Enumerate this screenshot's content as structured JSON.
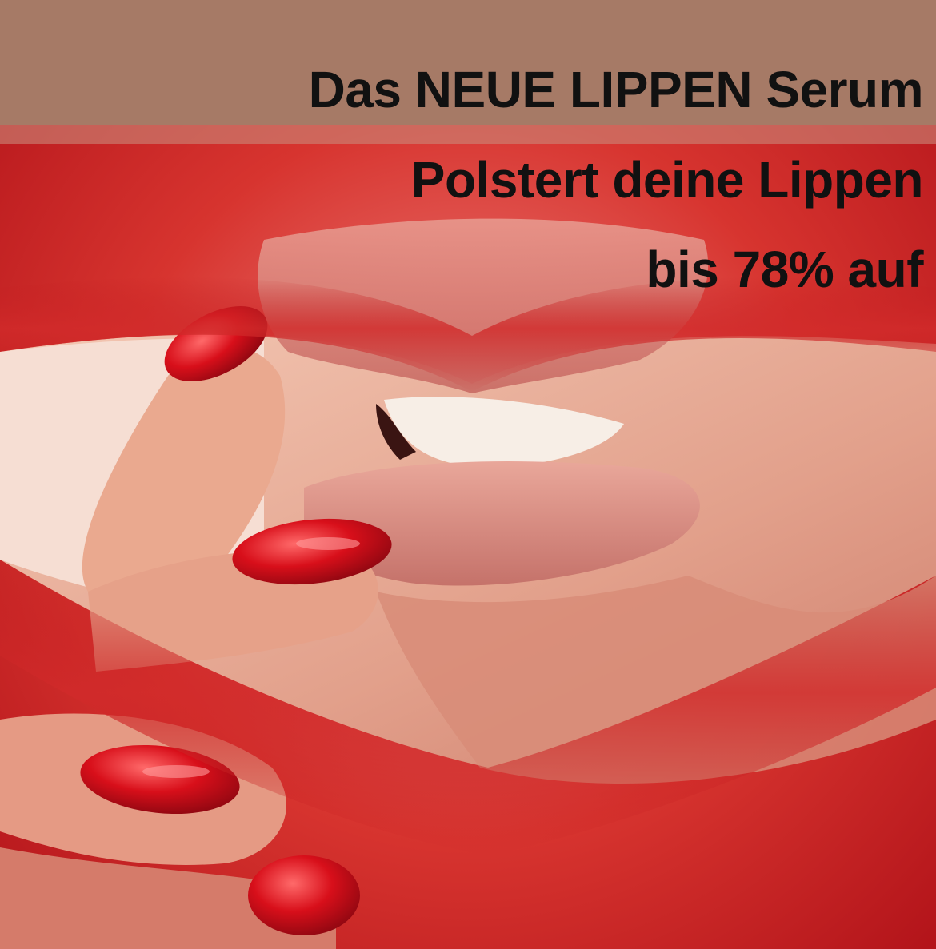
{
  "headline": {
    "line1": "Das NEUE LIPPEN Serum",
    "line2": "Polstert deine Lippen",
    "line3": "bis 78% auf"
  },
  "colors": {
    "top_band": "#a67a66",
    "lipstick_red": "#c9191c",
    "skin": "#e6a490",
    "text": "#111111"
  }
}
